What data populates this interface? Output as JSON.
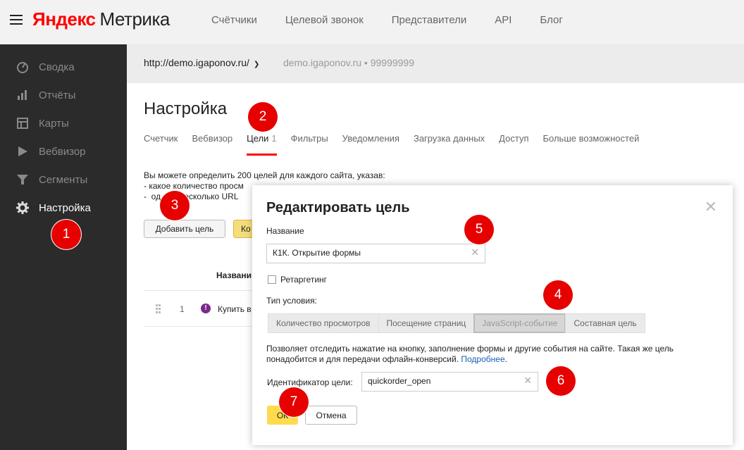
{
  "header": {
    "logo_brand": "Яндекс",
    "logo_product": "Метрика",
    "nav": [
      "Счётчики",
      "Целевой звонок",
      "Представители",
      "API",
      "Блог"
    ]
  },
  "sidebar": {
    "items": [
      {
        "label": "Сводка",
        "icon": "gauge-icon"
      },
      {
        "label": "Отчёты",
        "icon": "bar-chart-icon"
      },
      {
        "label": "Карты",
        "icon": "map-icon"
      },
      {
        "label": "Вебвизор",
        "icon": "play-icon"
      },
      {
        "label": "Сегменты",
        "icon": "filter-icon"
      },
      {
        "label": "Настройка",
        "icon": "gear-icon",
        "active": true
      }
    ]
  },
  "sitebar": {
    "url": "http://demo.igaponov.ru/",
    "meta": "demo.igaponov.ru • 99999999"
  },
  "main": {
    "title": "Настройка",
    "tabs": [
      {
        "label": "Счетчик"
      },
      {
        "label": "Вебвизор"
      },
      {
        "label": "Цели",
        "count": "1",
        "active": true
      },
      {
        "label": "Фильтры"
      },
      {
        "label": "Уведомления"
      },
      {
        "label": "Загрузка данных"
      },
      {
        "label": "Доступ"
      },
      {
        "label": "Больше возможностей"
      }
    ],
    "desc_line1": "Вы можете определить 200 целей для каждого сайта, указав:",
    "desc_line2": "-  какое количество просм",
    "desc_line3": "-  од        несколько URL",
    "add_goal_button": "Добавить цель",
    "yellow_button_partial": "Ко",
    "column_header": "Названи",
    "row": {
      "num": "1",
      "name": "Купить в"
    }
  },
  "modal": {
    "title": "Редактировать цель",
    "name_label": "Название",
    "name_value": "К1К. Открытие формы",
    "retargeting_label": "Ретаргетинг",
    "condition_label": "Тип условия:",
    "conditions": [
      "Количество просмотров",
      "Посещение страниц",
      "JavaScript-событие",
      "Составная цель"
    ],
    "selected_condition": "JavaScript-событие",
    "hint_text": "Позволяет отследить нажатие на кнопку, заполнение формы и другие события на сайте. Такая же цель понадобится и для передачи офлайн-конверсий.",
    "hint_link": "Подробнее",
    "hint_dot": ".",
    "id_label": "Идентификатор цели:",
    "id_value": "quickorder_open",
    "ok_button": "ОК",
    "cancel_button": "Отмена"
  },
  "markers": [
    "1",
    "2",
    "3",
    "4",
    "5",
    "6",
    "7"
  ],
  "colors": {
    "accent_red": "#e60000",
    "ok_yellow": "#ffdb4d",
    "sidebar_bg": "#2b2b2b",
    "link_blue": "#1a5fb4"
  }
}
